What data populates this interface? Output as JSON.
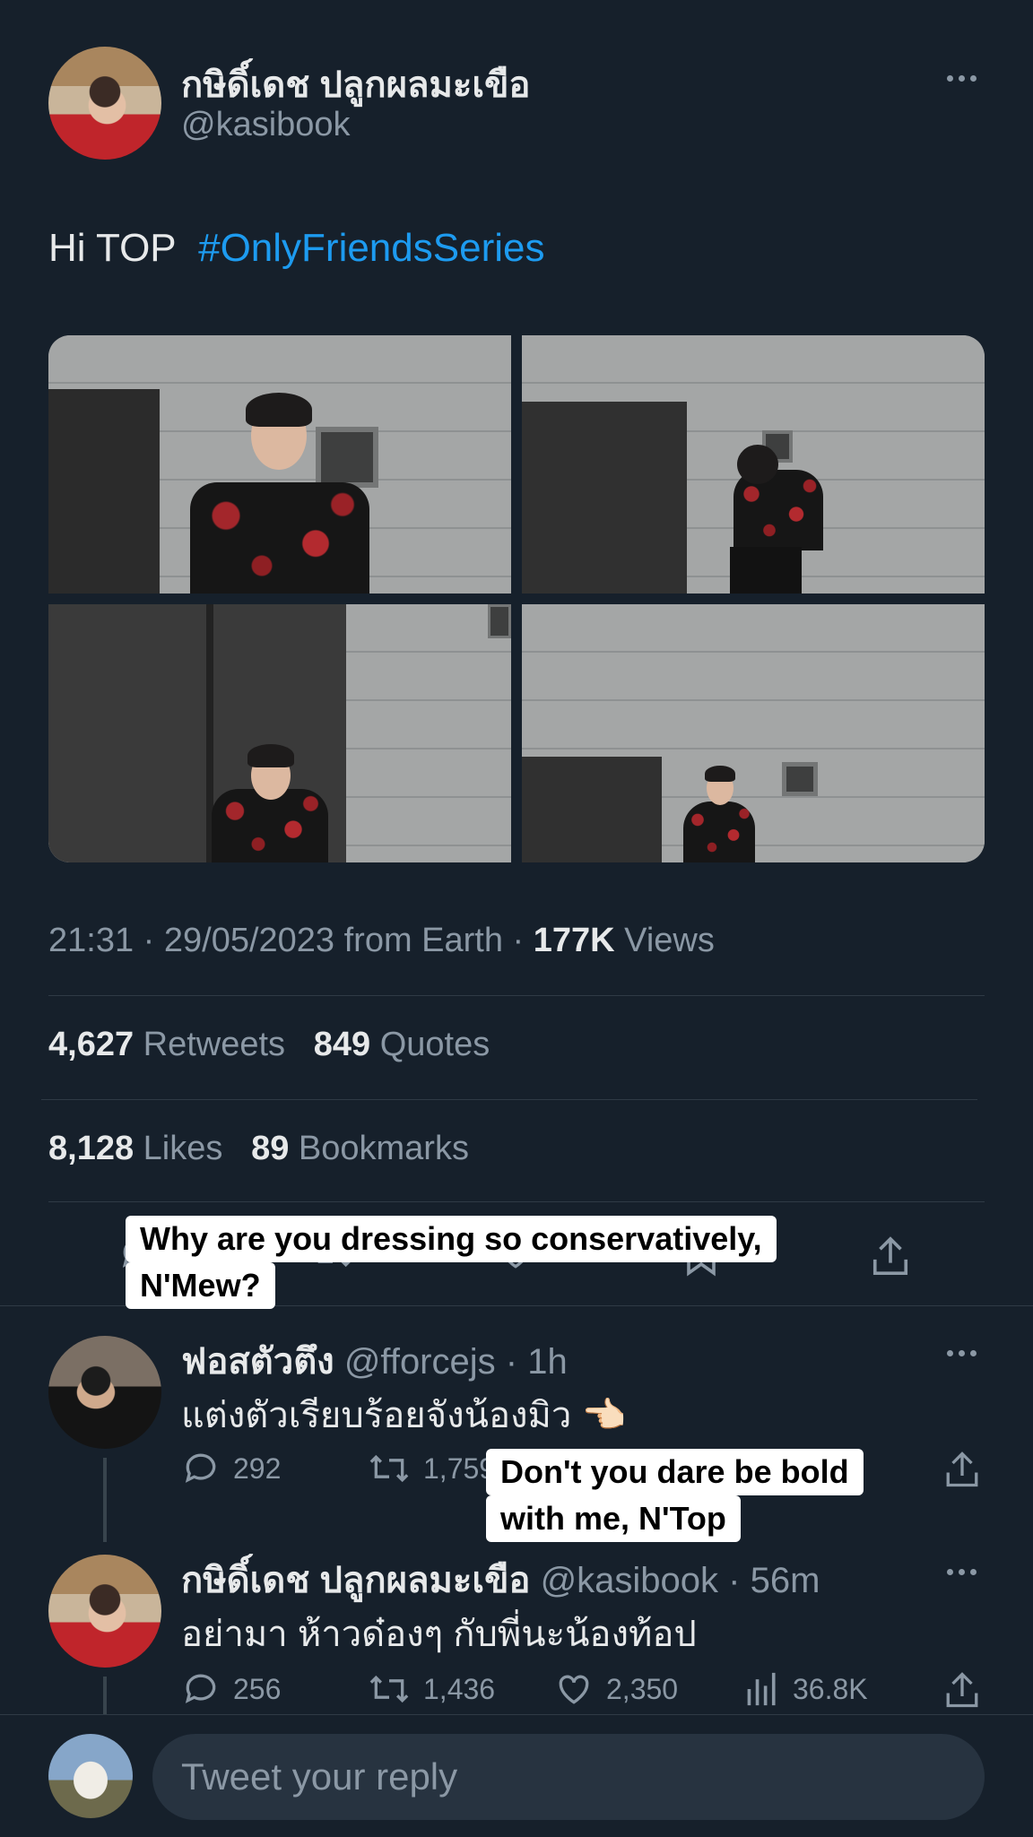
{
  "tweet": {
    "author_name": "กษิดิ์เดช ปลูกผลมะเขือ",
    "author_handle": "@kasibook",
    "text_plain": "Hi TOP",
    "hashtag": "#OnlyFriendsSeries",
    "meta_time": "21:31 · 29/05/2023 from Earth · ",
    "views_count": "177K",
    "views_label": "Views",
    "retweets_count": "4,627",
    "retweets_label": "Retweets",
    "quotes_count": "849",
    "quotes_label": "Quotes",
    "likes_count": "8,128",
    "likes_label": "Likes",
    "bookmarks_count": "89",
    "bookmarks_label": "Bookmarks"
  },
  "captions": {
    "first_line1": "Why are you dressing so conservatively,",
    "first_line2": "N'Mew?",
    "second_line1": "Don't you dare be bold",
    "second_line2": "with me, N'Top"
  },
  "replies": [
    {
      "name": "ฟอสตัวตึง",
      "handle": "@fforcejs",
      "time": "· 1h",
      "text": "แต่งตัวเรียบร้อยจังน้องมิว 👈🏻",
      "replies": "292",
      "retweets": "1,759"
    },
    {
      "name": "กษิดิ์เดช ปลูกผลมะเขือ",
      "handle": "@kasibook",
      "time": "· 56m",
      "text": "อย่ามา ห้าวด๋องๆ กับพี่นะน้องท้อป",
      "replies": "256",
      "retweets": "1,436",
      "likes": "2,350",
      "views": "36.8K"
    }
  ],
  "composer": {
    "placeholder": "Tweet your reply"
  },
  "icons": [
    "more-icon",
    "reply-icon",
    "retweet-icon",
    "like-icon",
    "bookmark-icon",
    "share-icon",
    "views-icon"
  ],
  "colors": {
    "background": "#16202b",
    "accent": "#1d9bf0",
    "muted": "#8b98a5"
  }
}
